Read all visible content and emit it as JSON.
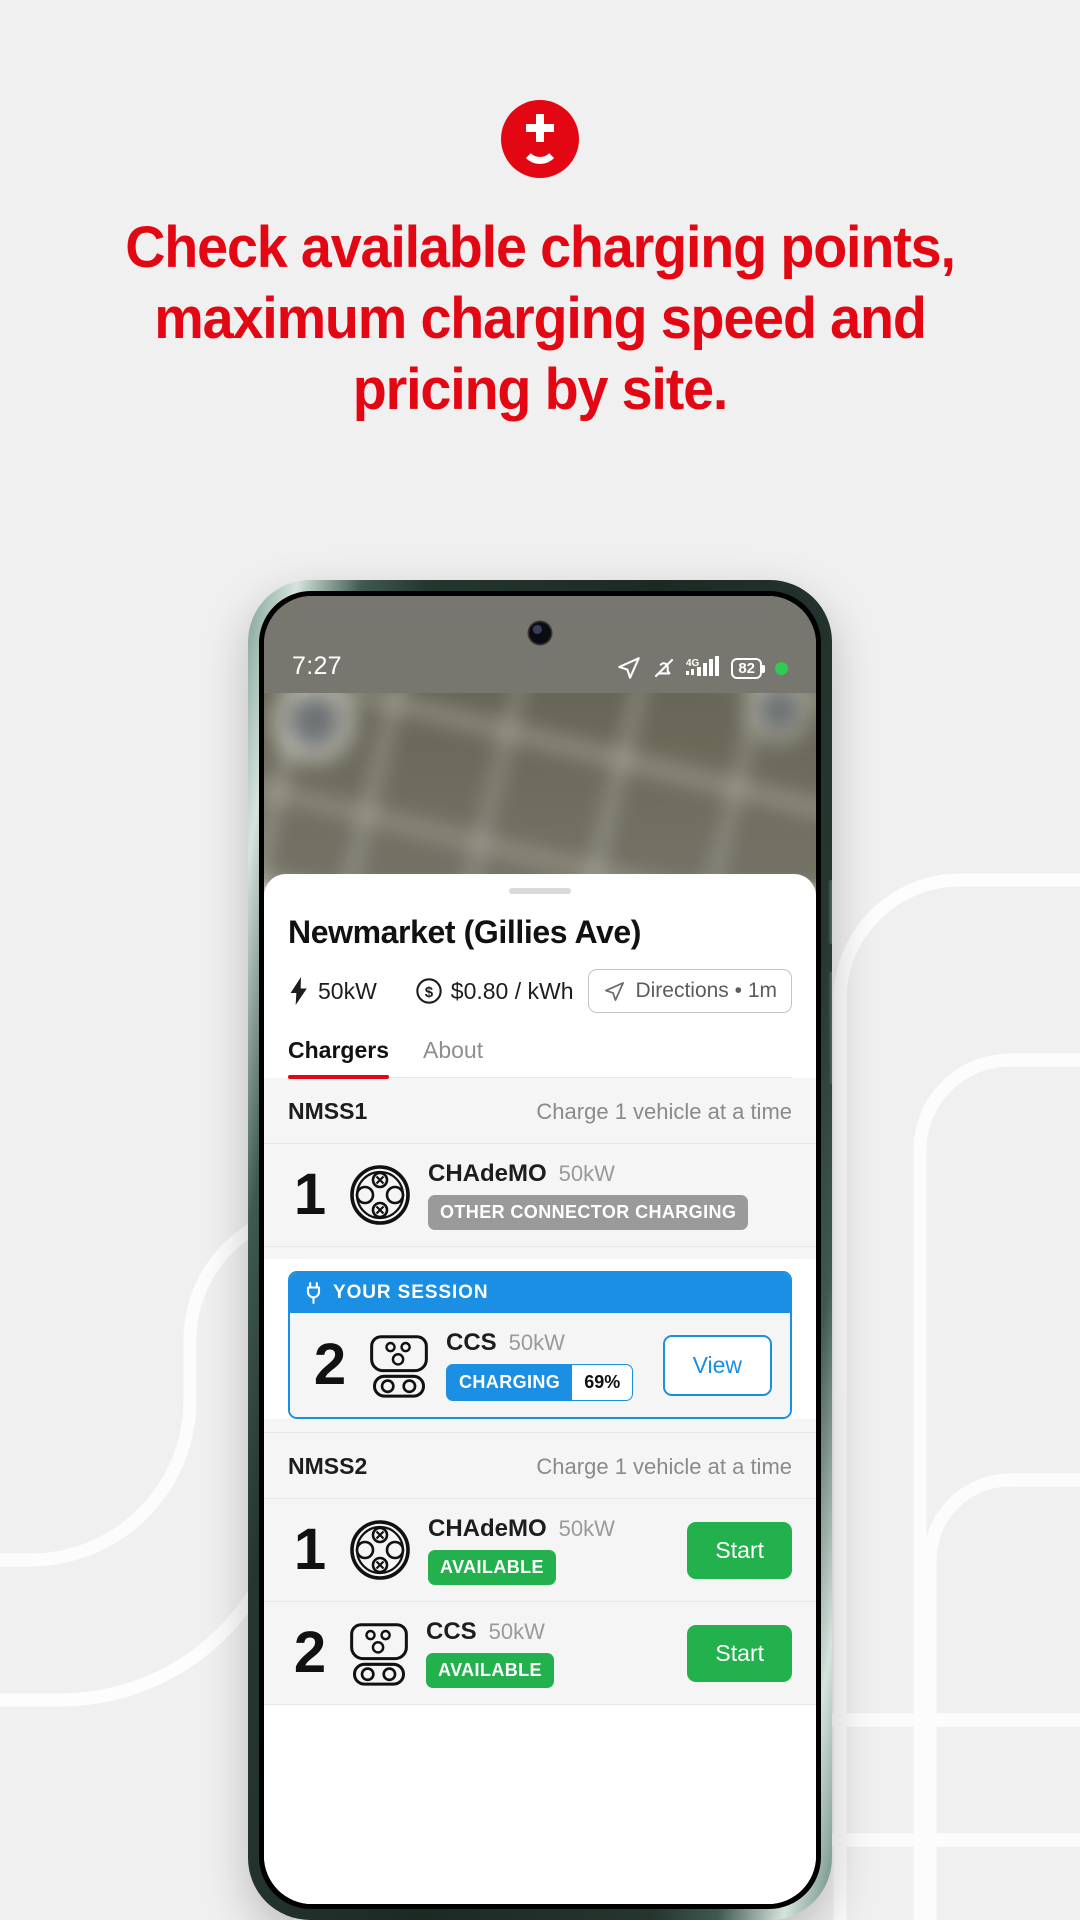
{
  "brand": {
    "logo_icon": "plus-smile-logo-icon",
    "accent_red": "#e30613",
    "accent_blue": "#1a8fe3",
    "accent_green": "#22b14c"
  },
  "headline": {
    "line1": "Check available charging points,",
    "line2": "maximum charging speed and",
    "line3": "pricing by site."
  },
  "phone": {
    "status_bar": {
      "time": "7:27",
      "location_icon": "location-arrow-icon",
      "mute_icon": "bell-muted-icon",
      "network_label": "4G",
      "signal_icon": "signal-bars-icon",
      "battery_level": "82",
      "recording_dot": "green-status-dot-icon"
    },
    "sheet": {
      "grabber": "sheet-grabber",
      "site_title": "Newmarket (Gillies Ave)",
      "meta": {
        "power_icon": "bolt-icon",
        "power": "50kW",
        "price_icon": "dollar-circle-icon",
        "price": "$0.80 / kWh",
        "directions_icon": "navigation-arrow-icon",
        "directions_label": "Directions • 1m"
      },
      "tabs": [
        {
          "label": "Chargers",
          "active": true
        },
        {
          "label": "About",
          "active": false
        }
      ],
      "sections": [
        {
          "name": "NMSS1",
          "note": "Charge 1 vehicle at a time",
          "rows": [
            {
              "number": "1",
              "connector_icon": "chademo-connector-icon",
              "connector": "CHAdeMO",
              "power": "50kW",
              "status": "OTHER CONNECTOR CHARGING",
              "status_style": "grey",
              "action": null
            }
          ]
        },
        {
          "name": "NMSS2",
          "note": "Charge 1 vehicle at a time",
          "rows": [
            {
              "number": "1",
              "connector_icon": "chademo-connector-icon",
              "connector": "CHAdeMO",
              "power": "50kW",
              "status": "AVAILABLE",
              "status_style": "green",
              "action": "Start"
            },
            {
              "number": "2",
              "connector_icon": "ccs-connector-icon",
              "connector": "CCS",
              "power": "50kW",
              "status": "AVAILABLE",
              "status_style": "green",
              "action": "Start"
            }
          ]
        }
      ],
      "your_session": {
        "header_icon": "plug-icon",
        "header_label": "YOUR SESSION",
        "number": "2",
        "connector_icon": "ccs-connector-icon",
        "connector": "CCS",
        "power": "50kW",
        "status_label": "CHARGING",
        "status_percent": "69%",
        "action": "View"
      }
    }
  }
}
